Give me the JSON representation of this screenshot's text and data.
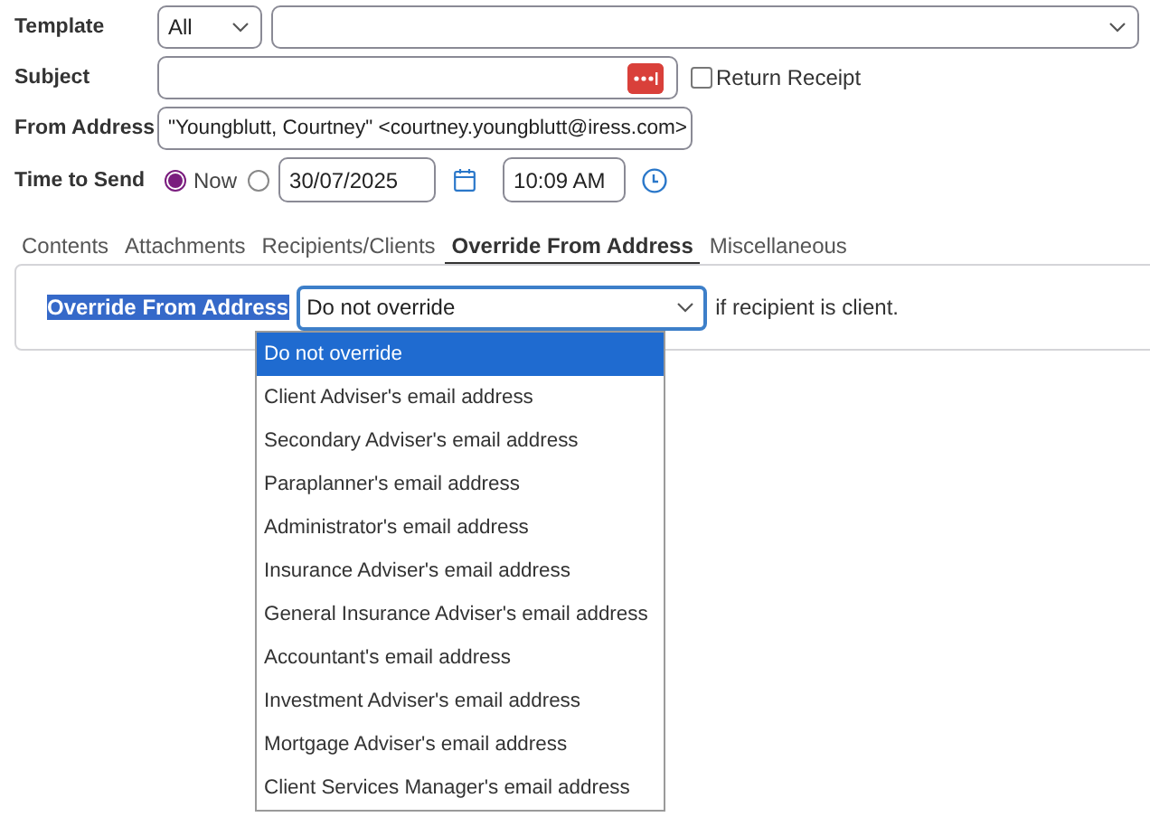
{
  "template": {
    "label": "Template",
    "category": "All"
  },
  "subject": {
    "label": "Subject",
    "return_receipt": {
      "label": "Return Receipt",
      "checked": false
    }
  },
  "from_address": {
    "label": "From Address",
    "value": "\"Youngblutt, Courtney\" <courtney.youngblutt@iress.com>"
  },
  "time_to_send": {
    "label": "Time to Send",
    "now": {
      "label": "Now",
      "selected": true
    },
    "scheduled": {
      "selected": false
    },
    "date": "30/07/2025",
    "time": "10:09 AM"
  },
  "tabs": [
    {
      "label": "Contents",
      "selected": false
    },
    {
      "label": "Attachments",
      "selected": false
    },
    {
      "label": "Recipients/Clients",
      "selected": false
    },
    {
      "label": "Override From Address",
      "selected": true
    },
    {
      "label": "Miscellaneous",
      "selected": false
    }
  ],
  "override": {
    "label": "Override From Address",
    "value": "Do not override",
    "suffix": "if recipient is client.",
    "dropdown_open": true,
    "options": [
      {
        "label": "Do not override",
        "selected": true
      },
      {
        "label": "Client Adviser's email address",
        "selected": false
      },
      {
        "label": "Secondary Adviser's email address",
        "selected": false
      },
      {
        "label": "Paraplanner's email address",
        "selected": false
      },
      {
        "label": "Administrator's email address",
        "selected": false
      },
      {
        "label": "Insurance Adviser's email address",
        "selected": false
      },
      {
        "label": "General Insurance Adviser's email address",
        "selected": false
      },
      {
        "label": "Accountant's email address",
        "selected": false
      },
      {
        "label": "Investment Adviser's email address",
        "selected": false
      },
      {
        "label": "Mortgage Adviser's email address",
        "selected": false
      },
      {
        "label": "Client Services Manager's email address",
        "selected": false
      }
    ]
  }
}
